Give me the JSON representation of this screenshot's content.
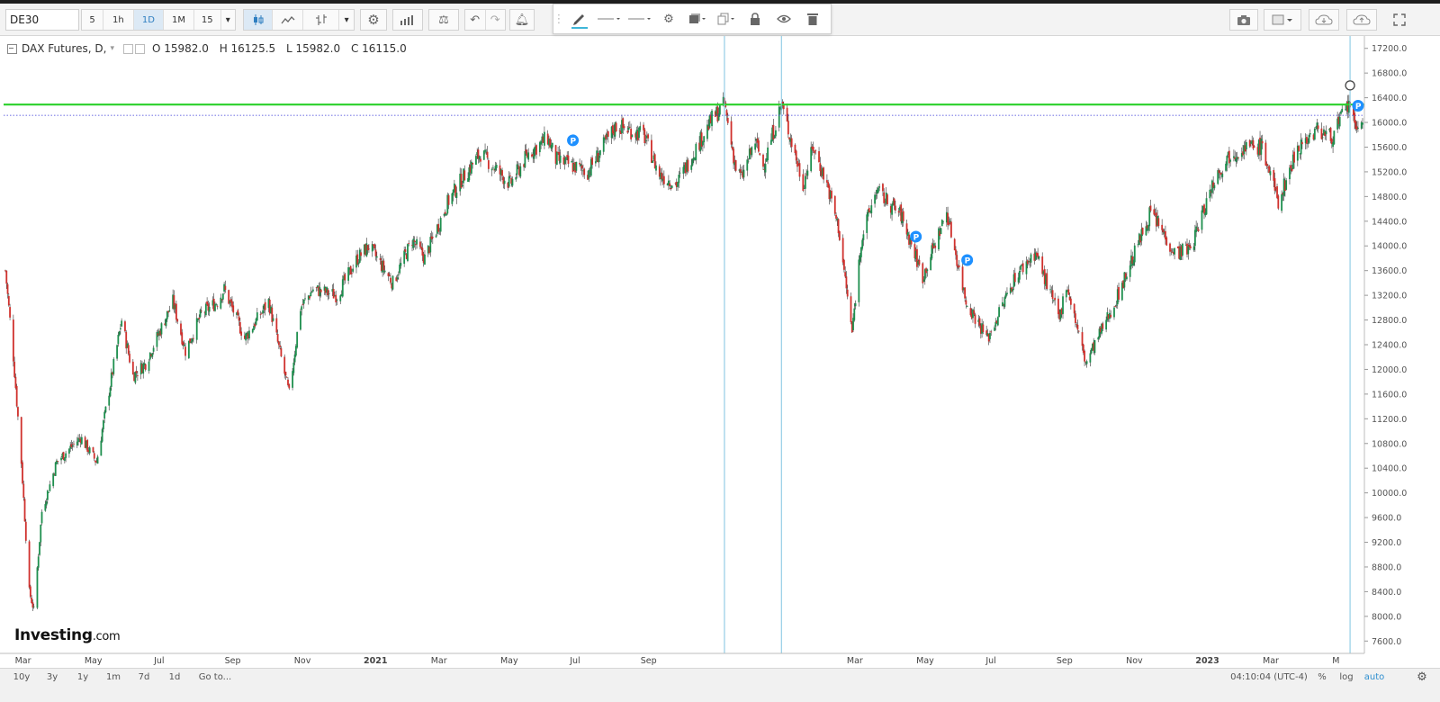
{
  "toolbar": {
    "symbol": "DE30",
    "intervals": [
      "5",
      "1h",
      "1D",
      "1M",
      "15"
    ],
    "active_interval": "1D",
    "icons": [
      "candles-icon",
      "line-chart-icon",
      "bar-style-icon",
      "dropdown-icon",
      "settings-icon",
      "indicators-icon",
      "compare-icon",
      "undo-icon",
      "redo-icon",
      "alert-icon"
    ],
    "right_icons": [
      "camera-icon",
      "layout-icon",
      "cloud-load-icon",
      "cloud-save-icon",
      "fullscreen-icon"
    ]
  },
  "drawing_toolbar": {
    "icons": [
      "pen-icon",
      "line-color-icon",
      "line-width-icon",
      "settings-icon",
      "layers-icon",
      "clone-icon",
      "lock-icon",
      "eye-icon",
      "trash-icon"
    ]
  },
  "legend": {
    "name": "DAX Futures, D,",
    "open": "O 15982.0",
    "high": "H 16125.5",
    "low": "L 15982.0",
    "close": "C 16115.0"
  },
  "bottombar": {
    "ranges": [
      "10y",
      "3y",
      "1y",
      "1m",
      "7d",
      "1d",
      "Go to..."
    ],
    "clock": "04:10:04 (UTC-4)",
    "options": [
      "%",
      "log",
      "auto"
    ],
    "active_option": "auto"
  },
  "logo": {
    "main": "Investing",
    "suffix": ".com"
  },
  "colors": {
    "up": "#1e8f4e",
    "down": "#d0312d",
    "green_line": "#2ad02a",
    "price_dotted": "#3a3ad8",
    "vline": "#7fc4e0",
    "axis_tag": "#4ea6c5"
  },
  "chart_data": {
    "type": "candlestick",
    "title": "DAX Futures, D,",
    "y_ticks": [
      7600,
      8000,
      8400,
      8800,
      9200,
      9600,
      10000,
      10400,
      10800,
      11200,
      11600,
      12000,
      12400,
      12800,
      13200,
      13600,
      14000,
      14400,
      14800,
      15200,
      15600,
      16000,
      16400,
      16800,
      17200
    ],
    "y_tick_labels": [
      "7600.0",
      "8000.0",
      "8400.0",
      "8800.0",
      "9200.0",
      "9600.0",
      "10000.0",
      "10400.0",
      "10800.0",
      "11200.0",
      "11600.0",
      "12000.0",
      "12400.0",
      "12800.0",
      "13200.0",
      "13600.0",
      "14000.0",
      "14400.0",
      "14800.0",
      "15200.0",
      "15600.0",
      "16000.0",
      "16400.0",
      "16800.0",
      "17200.0"
    ],
    "ylim": [
      7400,
      17400
    ],
    "x_labels": [
      {
        "date": "2020-03-01",
        "label": "Mar",
        "bold": false
      },
      {
        "date": "2020-05-01",
        "label": "May",
        "bold": false
      },
      {
        "date": "2020-07-01",
        "label": "Jul",
        "bold": false
      },
      {
        "date": "2020-09-01",
        "label": "Sep",
        "bold": false
      },
      {
        "date": "2020-11-01",
        "label": "Nov",
        "bold": false
      },
      {
        "date": "2021-01-01",
        "label": "2021",
        "bold": true
      },
      {
        "date": "2021-03-01",
        "label": "Mar",
        "bold": false
      },
      {
        "date": "2021-05-01",
        "label": "May",
        "bold": false
      },
      {
        "date": "2021-07-01",
        "label": "Jul",
        "bold": false
      },
      {
        "date": "2021-09-01",
        "label": "Sep",
        "bold": false
      },
      {
        "date": "2022-03-01",
        "label": "Mar",
        "bold": false
      },
      {
        "date": "2022-05-01",
        "label": "May",
        "bold": false
      },
      {
        "date": "2022-07-01",
        "label": "Jul",
        "bold": false
      },
      {
        "date": "2022-09-01",
        "label": "Sep",
        "bold": false
      },
      {
        "date": "2022-11-01",
        "label": "Nov",
        "bold": false
      },
      {
        "date": "2023-01-01",
        "label": "2023",
        "bold": true
      },
      {
        "date": "2023-03-01",
        "label": "Mar",
        "bold": false
      },
      {
        "date": "2023-05-01",
        "label": "M",
        "bold": false
      }
    ],
    "x_range": [
      "2020-02-24",
      "2023-05-30"
    ],
    "vertical_markers": [
      {
        "date": "2021-11-16",
        "label": "2021-11-16"
      },
      {
        "date": "2022-01-05",
        "label": "2022-01-05"
      },
      {
        "date": "2023-05-19",
        "label": "2023-05-19"
      }
    ],
    "horizontal_lines": [
      {
        "value": 16289.4,
        "label": "16289.4",
        "style": "solid-green"
      },
      {
        "value": 16115.0,
        "label": "16115.0",
        "style": "dotted-blue"
      }
    ],
    "price_tags": [
      {
        "value": 16668.4,
        "label": "16668.4"
      }
    ],
    "p_markers": [
      {
        "date": "2021-07-06",
        "value": 15710
      },
      {
        "date": "2022-05-03",
        "value": 14150
      },
      {
        "date": "2022-06-17",
        "value": 13770
      },
      {
        "date": "2023-05-26",
        "value": 16270
      }
    ],
    "circle_marker": {
      "date": "2023-05-19",
      "value": 16600
    },
    "anchors": [
      [
        "2020-02-24",
        13600
      ],
      [
        "2020-03-02",
        12200
      ],
      [
        "2020-03-09",
        10500
      ],
      [
        "2020-03-16",
        8400
      ],
      [
        "2020-03-20",
        8100
      ],
      [
        "2020-03-27",
        9700
      ],
      [
        "2020-04-09",
        10500
      ],
      [
        "2020-04-30",
        10900
      ],
      [
        "2020-05-14",
        10500
      ],
      [
        "2020-06-05",
        12800
      ],
      [
        "2020-06-15",
        11900
      ],
      [
        "2020-06-26",
        12100
      ],
      [
        "2020-07-20",
        13100
      ],
      [
        "2020-07-31",
        12300
      ],
      [
        "2020-08-14",
        12900
      ],
      [
        "2020-08-28",
        13100
      ],
      [
        "2020-09-03",
        13300
      ],
      [
        "2020-09-21",
        12500
      ],
      [
        "2020-10-12",
        13100
      ],
      [
        "2020-10-30",
        11600
      ],
      [
        "2020-11-09",
        13000
      ],
      [
        "2020-11-20",
        13300
      ],
      [
        "2020-12-11",
        13200
      ],
      [
        "2020-12-29",
        13800
      ],
      [
        "2021-01-08",
        14000
      ],
      [
        "2021-01-29",
        13400
      ],
      [
        "2021-02-15",
        14100
      ],
      [
        "2021-02-26",
        13800
      ],
      [
        "2021-03-18",
        14700
      ],
      [
        "2021-03-31",
        15100
      ],
      [
        "2021-04-16",
        15500
      ],
      [
        "2021-05-12",
        15000
      ],
      [
        "2021-05-28",
        15500
      ],
      [
        "2021-06-14",
        15750
      ],
      [
        "2021-06-21",
        15400
      ],
      [
        "2021-07-19",
        15200
      ],
      [
        "2021-08-13",
        15950
      ],
      [
        "2021-09-06",
        15800
      ],
      [
        "2021-09-20",
        15150
      ],
      [
        "2021-10-05",
        15000
      ],
      [
        "2021-10-21",
        15550
      ],
      [
        "2021-11-05",
        16050
      ],
      [
        "2021-11-16",
        16290
      ],
      [
        "2021-11-26",
        15250
      ],
      [
        "2021-12-01",
        15100
      ],
      [
        "2021-12-13",
        15700
      ],
      [
        "2021-12-20",
        15300
      ],
      [
        "2022-01-05",
        16290
      ],
      [
        "2022-01-24",
        15000
      ],
      [
        "2022-02-02",
        15600
      ],
      [
        "2022-02-14",
        15000
      ],
      [
        "2022-02-24",
        14300
      ],
      [
        "2022-03-08",
        12600
      ],
      [
        "2022-03-16",
        14100
      ],
      [
        "2022-03-29",
        14900
      ],
      [
        "2022-04-20",
        14500
      ],
      [
        "2022-05-09",
        13500
      ],
      [
        "2022-05-30",
        14550
      ],
      [
        "2022-06-16",
        13100
      ],
      [
        "2022-07-05",
        12500
      ],
      [
        "2022-07-29",
        13500
      ],
      [
        "2022-08-16",
        13900
      ],
      [
        "2022-09-06",
        12800
      ],
      [
        "2022-09-12",
        13400
      ],
      [
        "2022-09-29",
        12100
      ],
      [
        "2022-10-25",
        13100
      ],
      [
        "2022-11-25",
        14550
      ],
      [
        "2022-12-16",
        13900
      ],
      [
        "2022-12-30",
        13950
      ],
      [
        "2023-01-20",
        15100
      ],
      [
        "2023-02-03",
        15500
      ],
      [
        "2023-02-16",
        15600
      ],
      [
        "2023-03-03",
        15600
      ],
      [
        "2023-03-17",
        14700
      ],
      [
        "2023-04-03",
        15600
      ],
      [
        "2023-04-21",
        15900
      ],
      [
        "2023-05-02",
        15750
      ],
      [
        "2023-05-19",
        16320
      ],
      [
        "2023-05-24",
        15800
      ],
      [
        "2023-05-30",
        16115
      ]
    ]
  }
}
